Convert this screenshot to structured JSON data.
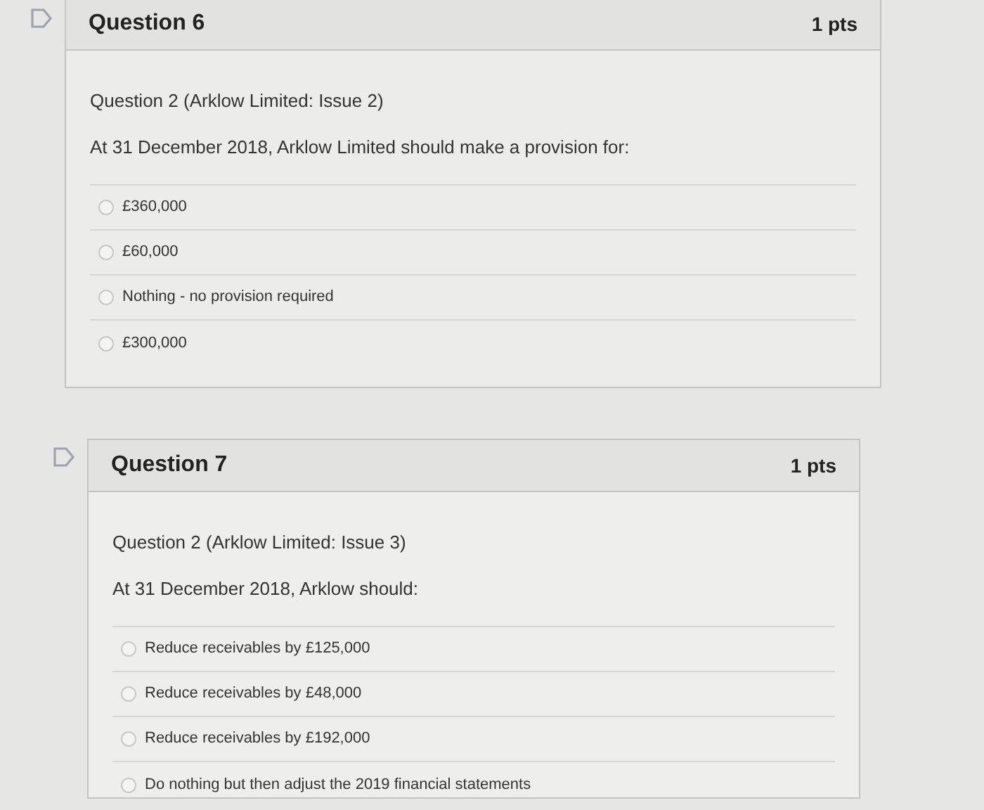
{
  "questions": [
    {
      "title": "Question 6",
      "points": "1 pts",
      "subtitle": "Question 2 (Arklow Limited: Issue 2)",
      "prompt": "At 31 December 2018, Arklow Limited should make a provision for:",
      "options": [
        {
          "label": "£360,000",
          "selected": false
        },
        {
          "label": "£60,000",
          "selected": false
        },
        {
          "label": "Nothing - no provision required",
          "selected": false
        },
        {
          "label": "£300,000",
          "selected": false
        }
      ]
    },
    {
      "title": "Question 7",
      "points": "1 pts",
      "subtitle": "Question 2 (Arklow Limited: Issue 3)",
      "prompt": "At 31 December 2018, Arklow should:",
      "options": [
        {
          "label": "Reduce receivables by £125,000",
          "selected": false
        },
        {
          "label": "Reduce receivables by £48,000",
          "selected": false
        },
        {
          "label": "Reduce receivables by £192,000",
          "selected": false
        },
        {
          "label": "Do nothing but then adjust the 2019 financial statements",
          "selected": false
        }
      ]
    }
  ]
}
